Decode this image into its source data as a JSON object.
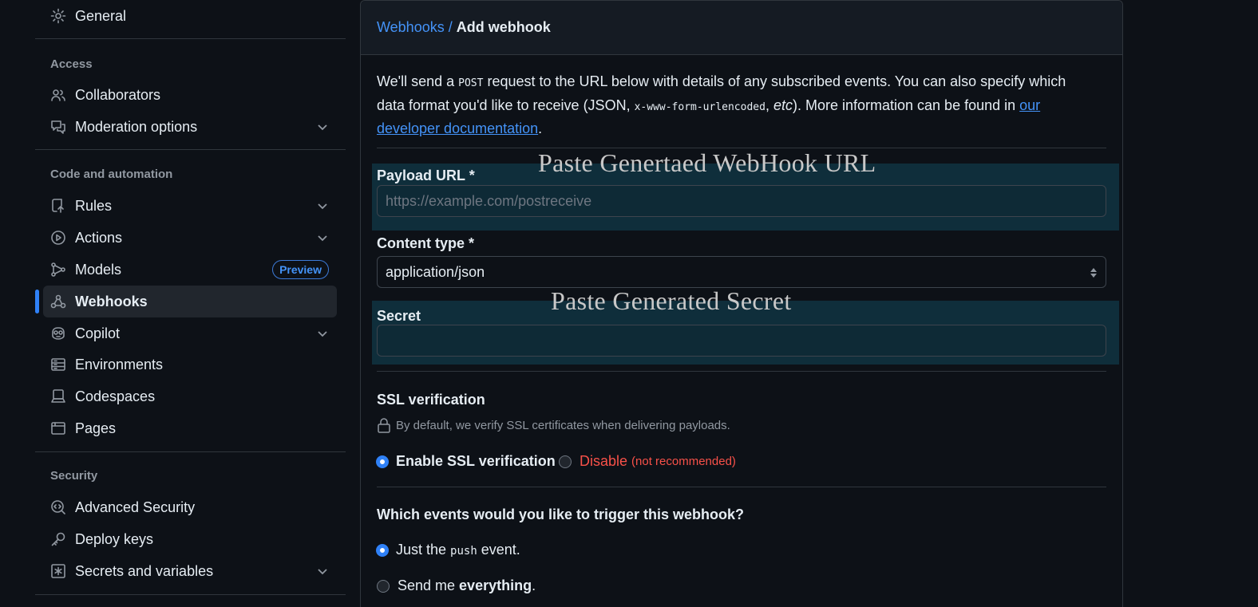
{
  "sidebar": {
    "general": "General",
    "sections": {
      "access": "Access",
      "code_automation": "Code and automation",
      "security": "Security"
    },
    "items": {
      "collaborators": "Collaborators",
      "moderation": "Moderation options",
      "rules": "Rules",
      "actions": "Actions",
      "models": "Models",
      "models_badge": "Preview",
      "webhooks": "Webhooks",
      "copilot": "Copilot",
      "environments": "Environments",
      "codespaces": "Codespaces",
      "pages": "Pages",
      "advanced_security": "Advanced Security",
      "deploy_keys": "Deploy keys",
      "secrets": "Secrets and variables"
    }
  },
  "breadcrumb": {
    "parent": "Webhooks",
    "separator": "/",
    "current": "Add webhook"
  },
  "intro": {
    "p1": "We'll send a ",
    "post": "POST",
    "p2": " request to the URL below with details of any subscribed events. You can also specify which data format you'd like to receive (JSON, ",
    "urlencoded": "x-www-form-urlencoded",
    "p3": ", ",
    "etc": "etc",
    "p4": "). More information can be found in ",
    "link": "our developer documentation",
    "p5": "."
  },
  "annotations": {
    "url": "Paste Genertaed WebHook URL",
    "secret": "Paste Generated Secret"
  },
  "form": {
    "payload_label": "Payload URL *",
    "payload_placeholder": "https://example.com/postreceive",
    "payload_value": "",
    "content_type_label": "Content type *",
    "content_type_value": "application/json",
    "secret_label": "Secret",
    "secret_value": ""
  },
  "ssl": {
    "title": "SSL verification",
    "note": "By default, we verify SSL certificates when delivering payloads.",
    "enable": "Enable SSL verification",
    "disable": "Disable",
    "disable_note": "(not recommended)"
  },
  "events": {
    "title": "Which events would you like to trigger this webhook?",
    "just_pre": "Just the ",
    "just_code": "push",
    "just_post": " event.",
    "everything_pre": "Send me ",
    "everything_bold": "everything",
    "everything_post": "."
  },
  "colors": {
    "accent": "#2f81f7",
    "link": "#4493f8",
    "danger": "#f85149",
    "highlight": "#0f2e3b"
  }
}
